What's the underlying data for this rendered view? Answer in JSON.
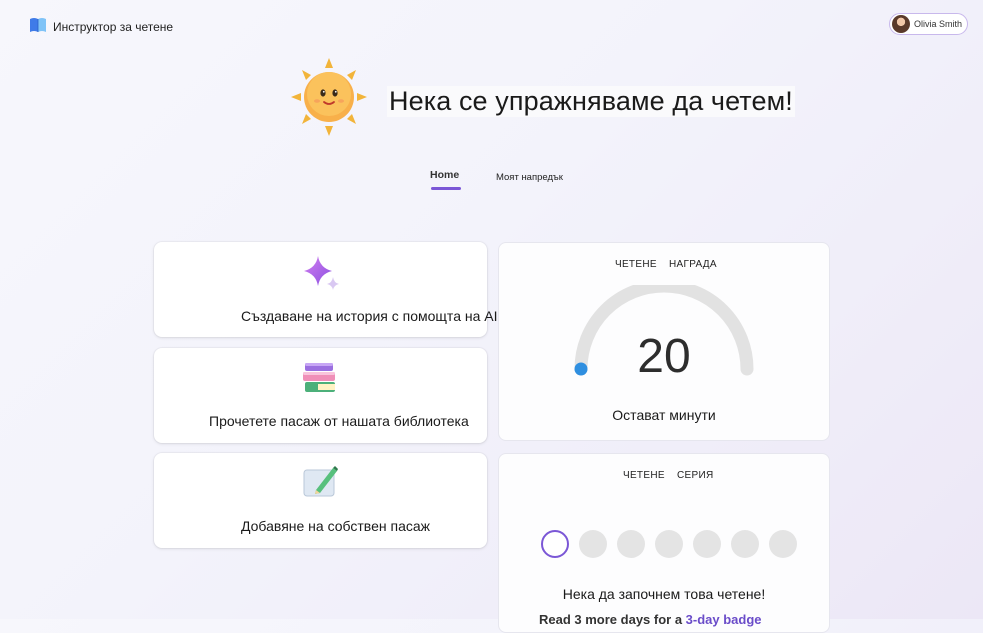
{
  "app": {
    "title": "Инструктор за четене",
    "user_name": "Olivia Smith"
  },
  "hero": {
    "title": "Нека се упражняваме да четем!"
  },
  "tabs": [
    {
      "label": "Home",
      "selected": true
    },
    {
      "label": "Моят напредък",
      "selected": false
    }
  ],
  "actions": [
    {
      "label": "Създаване на история с помощта на AI",
      "icon": "sparkle-icon"
    },
    {
      "label": "Прочетете пасаж от нашата библиотека",
      "icon": "books-icon"
    },
    {
      "label": "Добавяне на собствен пасаж",
      "icon": "notepad-pencil-icon"
    }
  ],
  "award": {
    "heading_1": "ЧЕТЕНЕ",
    "heading_2": "НАГРАДА",
    "minutes_left": "20",
    "caption": "Остават минути",
    "progress_fraction": 0.0
  },
  "streak": {
    "heading_1": "ЧЕТЕНЕ",
    "heading_2": "СЕРИЯ",
    "days_total": 7,
    "days_done": 0,
    "message": "Нека да започнем това четене!",
    "sub_text": "Read 3 more days for a ",
    "sub_link": "3-day badge"
  },
  "colors": {
    "accent": "#7b57d6",
    "gauge_track": "#e2e2e2",
    "gauge_fill": "#2f8fe0"
  }
}
